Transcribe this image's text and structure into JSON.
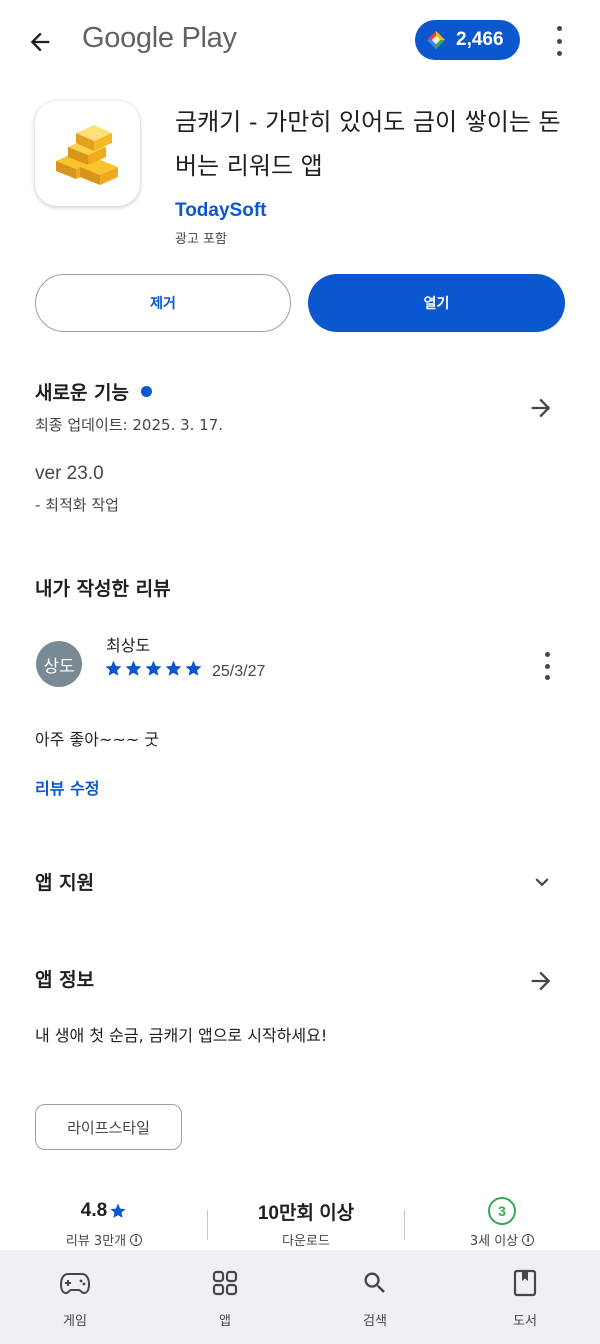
{
  "header": {
    "brand": "Google Play",
    "points": "2,466"
  },
  "app": {
    "title": "금캐기 - 가만히 있어도 금이 쌓이는 돈버는 리워드 앱",
    "developer": "TodaySoft",
    "ads_label": "광고 포함",
    "remove_label": "제거",
    "open_label": "열기"
  },
  "whats_new": {
    "title": "새로운 기능",
    "updated": "최종 업데이트: 2025. 3. 17.",
    "version": "ver 23.0",
    "notes": "- 최적화 작업"
  },
  "my_review": {
    "section_title": "내가 작성한 리뷰",
    "avatar_text": "상도",
    "reviewer": "최상도",
    "rating": 5,
    "date": "25/3/27",
    "text": "아주 좋아~~~ 굿",
    "edit_label": "리뷰 수정"
  },
  "app_support": {
    "title": "앱 지원"
  },
  "app_info": {
    "title": "앱 정보",
    "description": "내 생애 첫 순금, 금캐기 앱으로 시작하세요!",
    "category_chip": "라이프스타일"
  },
  "stats": {
    "rating": "4.8",
    "reviews": "리뷰 3만개",
    "downloads": "10만회 이상",
    "downloads_label": "다운로드",
    "age_badge": "3",
    "age_label": "3세 이상"
  },
  "bottom_nav": {
    "games": "게임",
    "apps": "앱",
    "search": "검색",
    "books": "도서"
  },
  "colors": {
    "accent": "#0b57d0",
    "age_green": "#34a853",
    "nav_bg": "#edf0f5"
  }
}
